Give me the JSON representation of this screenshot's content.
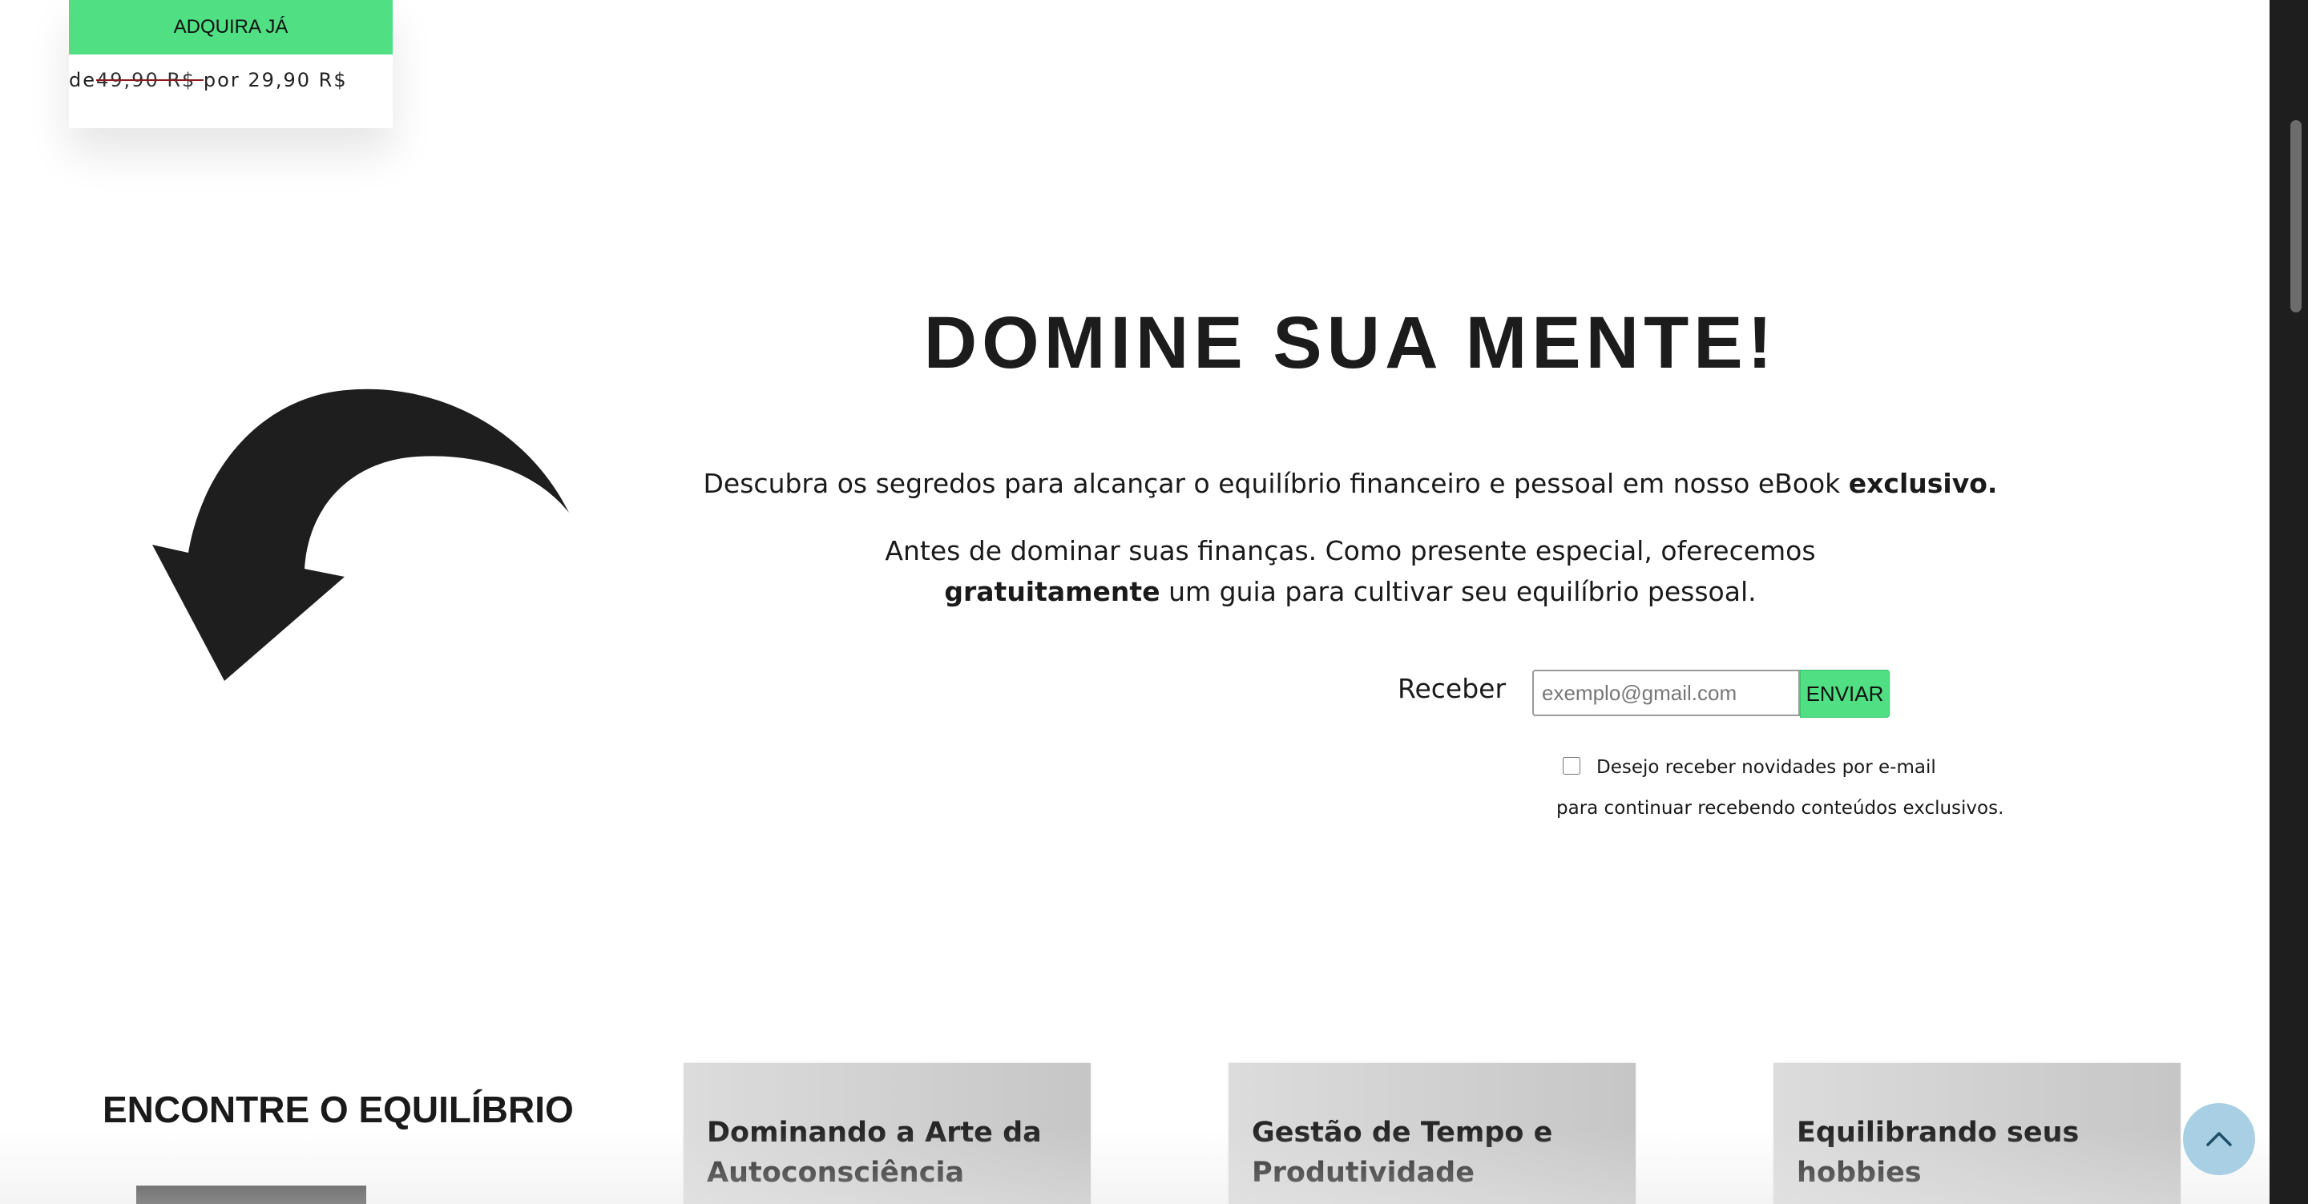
{
  "product": {
    "buy_label": "ADQUIRA JÁ",
    "price_prefix": "de",
    "price_old": "49,90 R$ ",
    "price_new": "por 29,90 R$"
  },
  "hero": {
    "title": "DOMINE SUA MENTE!",
    "line1_text": "Descubra os segredos para alcançar o equilíbrio financeiro e pessoal em nosso eBook ",
    "line1_bold": "exclusivo.",
    "line2_text_a": "Antes de dominar suas finanças. Como presente especial, oferecemos",
    "line2_bold": "gratuitamente",
    "line2_text_b": " um guia para cultivar seu equilíbrio pessoal."
  },
  "form": {
    "label": "Receber",
    "email_placeholder": "exemplo@gmail.com",
    "email_value": "",
    "submit_label": "ENVIAR",
    "optin_label": "Desejo receber novidades por e-mail",
    "optin_checked": false,
    "optin_note": "para continuar recebendo conteúdos exclusivos."
  },
  "section": {
    "title": "ENCONTRE O EQUILÍBRIO",
    "cards": [
      {
        "title": "Dominando a Arte da Autoconsciência"
      },
      {
        "title": "Gestão de Tempo e Produtividade"
      },
      {
        "title": "Equilibrando seus hobbies"
      }
    ]
  },
  "icons": {
    "arrow": "curved-arrow-icon",
    "back_to_top": "chevron-up-icon"
  },
  "colors": {
    "accent_green": "#50df83",
    "back_to_top_bg": "#a8cfe3",
    "card_bg": "#d2d2d2",
    "text_dark": "#1a1a1a"
  }
}
